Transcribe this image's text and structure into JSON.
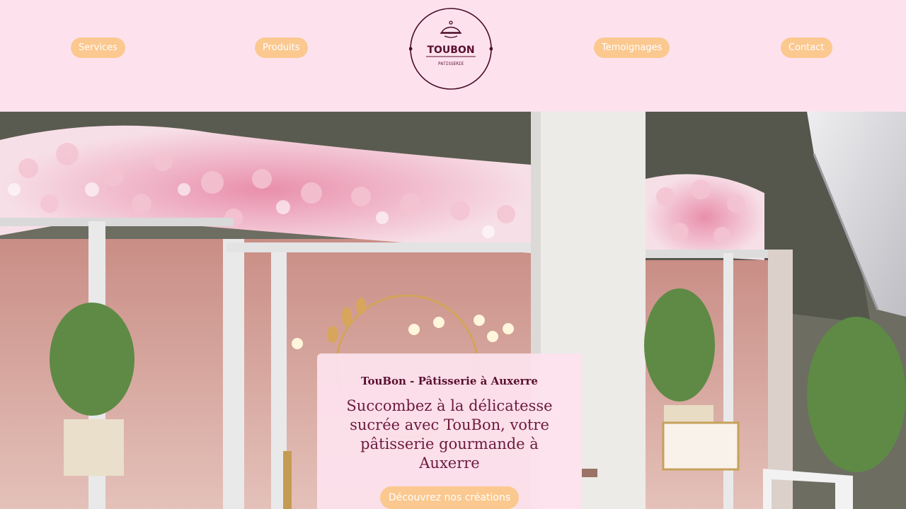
{
  "nav": {
    "services": "Services",
    "produits": "Produits",
    "temoignages": "Temoignages",
    "contact": "Contact"
  },
  "logo": {
    "brand": "TOUBON",
    "subtitle": "PATISSERIE",
    "icon": "cloche-icon"
  },
  "hero": {
    "title": "TouBon - Pâtisserie à Auxerre",
    "tagline": "Succombez à la délicatesse sucrée avec TouBon, votre pâtisserie gourmande à Auxerre",
    "cta": "Découvrez nos créations"
  },
  "colors": {
    "background": "#fde2ee",
    "accent": "#fbc88f",
    "brand": "#5a0f2f"
  }
}
